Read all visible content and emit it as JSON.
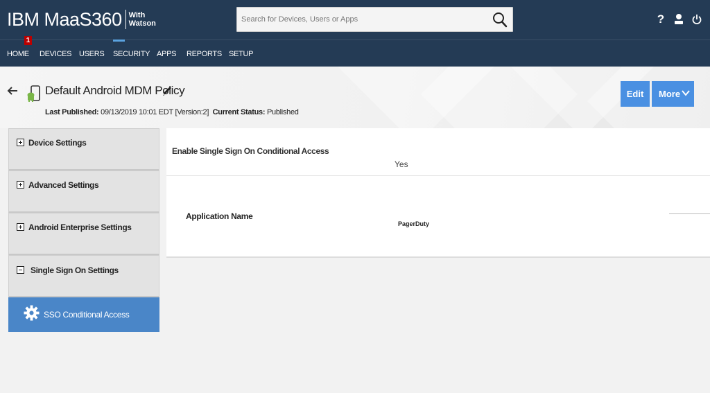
{
  "header": {
    "brand_main": "IBM MaaS360",
    "brand_with": "With",
    "brand_watson": "Watson",
    "search_placeholder": "Search for Devices, Users or Apps",
    "help_glyph": "?",
    "icons": [
      "search-icon",
      "help-icon",
      "user-icon",
      "power-icon"
    ]
  },
  "nav": {
    "items": [
      "HOME",
      "DEVICES",
      "USERS",
      "SECURITY",
      "APPS",
      "REPORTS",
      "SETUP"
    ],
    "active": "SECURITY",
    "home_badge": "1"
  },
  "page": {
    "title": "Default Android MDM Policy",
    "last_published_label": "Last Published:",
    "last_published_value": "09/13/2019 10:01 EDT",
    "version": "[Version:2]",
    "status_label": "Current Status:",
    "status_value": "Published",
    "edit_label": "Edit",
    "more_label": "More"
  },
  "sidebar": {
    "items": [
      {
        "label": "Device Settings",
        "state": "collapsed"
      },
      {
        "label": "Advanced Settings",
        "state": "collapsed"
      },
      {
        "label": "Android Enterprise Settings",
        "state": "collapsed"
      },
      {
        "label": "Single Sign On Settings",
        "state": "expanded"
      }
    ],
    "sub_item": {
      "label": "SSO Conditional Access",
      "icon": "gear-icon"
    }
  },
  "content": {
    "sso_label": "Enable Single Sign On Conditional Access",
    "sso_value": "Yes",
    "app_name_label": "Application Name",
    "app_name_value": "PagerDuty"
  },
  "colors": {
    "header_bg": "#243b55",
    "accent": "#4a90e2",
    "active_sub_bg": "#4a86c8",
    "badge_red": "#bb0000"
  }
}
